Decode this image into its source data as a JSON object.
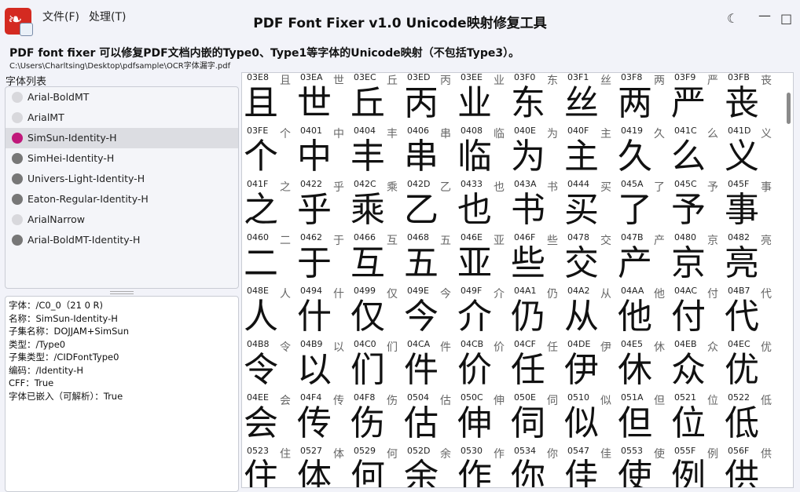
{
  "app": {
    "title": "PDF Font Fixer v1.0  Unicode映射修复工具",
    "icon": "pdf-app-icon",
    "accent": "#c0187a"
  },
  "menu": {
    "file": "文件(F)",
    "process": "处理(T)"
  },
  "header": {
    "subtitle": "PDF font fixer 可以修复PDF文档内嵌的Type0、Type1等字体的Unicode映射（不包括Type3）。",
    "path": "C:\\Users\\Charltsing\\Desktop\\pdfsample\\OCR字体漏字.pdf"
  },
  "font_list": {
    "label": "字体列表",
    "items": [
      {
        "label": "Arial-BoldMT",
        "dot": "light"
      },
      {
        "label": "ArialMT",
        "dot": "light"
      },
      {
        "label": "SimSun-Identity-H",
        "dot": "accent",
        "selected": true
      },
      {
        "label": "SimHei-Identity-H",
        "dot": "dark"
      },
      {
        "label": "Univers-Light-Identity-H",
        "dot": "dark"
      },
      {
        "label": "Eaton-Regular-Identity-H",
        "dot": "dark"
      },
      {
        "label": "ArialNarrow",
        "dot": "light"
      },
      {
        "label": "Arial-BoldMT-Identity-H",
        "dot": "dark"
      }
    ]
  },
  "font_info": [
    "字体：/C0_0（21 0 R)",
    "名称：SimSun-Identity-H",
    "子集名称：DOJJAM+SimSun",
    "类型：/Type0",
    "子集类型：/CIDFontType0",
    "编码：/Identity-H",
    "CFF：True",
    "字体已嵌入（可解析）：True"
  ],
  "glyphs": [
    {
      "code": "03E8",
      "char": "且"
    },
    {
      "code": "03EA",
      "char": "世"
    },
    {
      "code": "03EC",
      "char": "丘"
    },
    {
      "code": "03ED",
      "char": "丙"
    },
    {
      "code": "03EE",
      "char": "业"
    },
    {
      "code": "03F0",
      "char": "东"
    },
    {
      "code": "03F1",
      "char": "丝"
    },
    {
      "code": "03F8",
      "char": "两"
    },
    {
      "code": "03F9",
      "char": "严"
    },
    {
      "code": "03FB",
      "char": "丧"
    },
    {
      "code": "03FE",
      "char": "个"
    },
    {
      "code": "0401",
      "char": "中"
    },
    {
      "code": "0404",
      "char": "丰"
    },
    {
      "code": "0406",
      "char": "串"
    },
    {
      "code": "0408",
      "char": "临"
    },
    {
      "code": "040E",
      "char": "为"
    },
    {
      "code": "040F",
      "char": "主"
    },
    {
      "code": "0419",
      "char": "久"
    },
    {
      "code": "041C",
      "char": "么"
    },
    {
      "code": "041D",
      "char": "义"
    },
    {
      "code": "041F",
      "char": "之"
    },
    {
      "code": "0422",
      "char": "乎"
    },
    {
      "code": "042C",
      "char": "乘"
    },
    {
      "code": "042D",
      "char": "乙"
    },
    {
      "code": "0433",
      "char": "也"
    },
    {
      "code": "043A",
      "char": "书"
    },
    {
      "code": "0444",
      "char": "买"
    },
    {
      "code": "045A",
      "char": "了"
    },
    {
      "code": "045C",
      "char": "予"
    },
    {
      "code": "045F",
      "char": "事"
    },
    {
      "code": "0460",
      "char": "二"
    },
    {
      "code": "0462",
      "char": "于"
    },
    {
      "code": "0466",
      "char": "互"
    },
    {
      "code": "0468",
      "char": "五"
    },
    {
      "code": "046E",
      "char": "亚"
    },
    {
      "code": "046F",
      "char": "些"
    },
    {
      "code": "0478",
      "char": "交"
    },
    {
      "code": "047B",
      "char": "产"
    },
    {
      "code": "0480",
      "char": "京"
    },
    {
      "code": "0482",
      "char": "亮"
    },
    {
      "code": "048E",
      "char": "人"
    },
    {
      "code": "0494",
      "char": "什"
    },
    {
      "code": "0499",
      "char": "仅"
    },
    {
      "code": "049E",
      "char": "今"
    },
    {
      "code": "049F",
      "char": "介"
    },
    {
      "code": "04A1",
      "char": "仍"
    },
    {
      "code": "04A2",
      "char": "从"
    },
    {
      "code": "04AA",
      "char": "他"
    },
    {
      "code": "04AC",
      "char": "付"
    },
    {
      "code": "04B7",
      "char": "代"
    },
    {
      "code": "04B8",
      "char": "令"
    },
    {
      "code": "04B9",
      "char": "以"
    },
    {
      "code": "04C0",
      "char": "们"
    },
    {
      "code": "04CA",
      "char": "件"
    },
    {
      "code": "04CB",
      "char": "价"
    },
    {
      "code": "04CF",
      "char": "任"
    },
    {
      "code": "04DE",
      "char": "伊"
    },
    {
      "code": "04E5",
      "char": "休"
    },
    {
      "code": "04EB",
      "char": "众"
    },
    {
      "code": "04EC",
      "char": "优"
    },
    {
      "code": "04EE",
      "char": "会"
    },
    {
      "code": "04F4",
      "char": "传"
    },
    {
      "code": "04F8",
      "char": "伤"
    },
    {
      "code": "0504",
      "char": "估"
    },
    {
      "code": "050C",
      "char": "伸"
    },
    {
      "code": "050E",
      "char": "伺"
    },
    {
      "code": "0510",
      "char": "似"
    },
    {
      "code": "051A",
      "char": "但"
    },
    {
      "code": "0521",
      "char": "位"
    },
    {
      "code": "0522",
      "char": "低"
    },
    {
      "code": "0523",
      "char": "住"
    },
    {
      "code": "0527",
      "char": "体"
    },
    {
      "code": "0529",
      "char": "何"
    },
    {
      "code": "052D",
      "char": "余"
    },
    {
      "code": "0530",
      "char": "作"
    },
    {
      "code": "0534",
      "char": "你"
    },
    {
      "code": "0547",
      "char": "佳"
    },
    {
      "code": "0553",
      "char": "使"
    },
    {
      "code": "055F",
      "char": "例"
    },
    {
      "code": "056F",
      "char": "供"
    }
  ]
}
